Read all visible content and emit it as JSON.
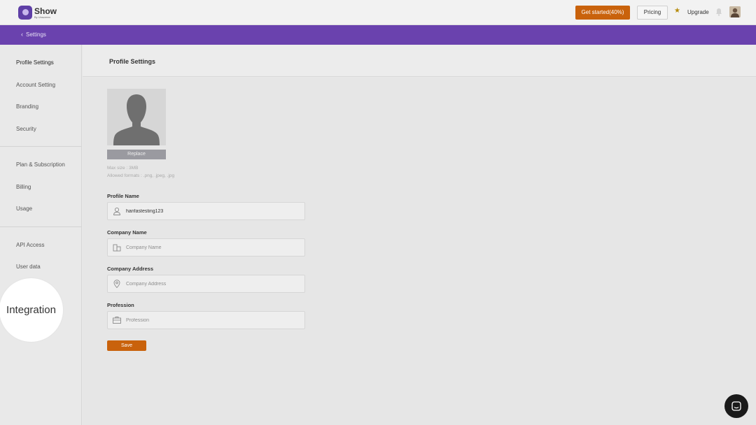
{
  "app": {
    "logo_title": "Show",
    "logo_sub": "By Unscreen",
    "brand_color": "#6a42ae",
    "accent_color": "#c9620c"
  },
  "topbar": {
    "get_started_label": "Get started(40%)",
    "pricing_label": "Pricing",
    "upgrade_label": "Upgrade",
    "icons": [
      "star-icon",
      "bell-icon",
      "avatar"
    ]
  },
  "subbar": {
    "back_label": "Settings",
    "back_icon": "chevron-left-icon"
  },
  "sidebar": {
    "groups": [
      [
        "Profile Settings",
        "Account Setting",
        "Branding",
        "Security"
      ],
      [
        "Plan & Subscription",
        "Billing",
        "Usage"
      ],
      [
        "API Access",
        "User data"
      ]
    ],
    "active": "Profile Settings",
    "spotlight_label": "Integration"
  },
  "main": {
    "title": "Profile Settings",
    "photo": {
      "replace_label": "Replace",
      "max_size": "Max size : 3MB",
      "formats": "Allowed formats : .png, .jpeg, .jpg"
    },
    "fields": {
      "profile_name": {
        "label": "Profile Name",
        "value": "hanfastesting123",
        "placeholder": "",
        "icon": "user-icon"
      },
      "company_name": {
        "label": "Company Name",
        "value": "",
        "placeholder": "Company Name",
        "icon": "building-icon"
      },
      "company_address": {
        "label": "Company Address",
        "value": "",
        "placeholder": "Company Address",
        "icon": "location-pin-icon"
      },
      "profession": {
        "label": "Profession",
        "value": "",
        "placeholder": "Profession",
        "icon": "briefcase-icon"
      }
    },
    "save_label": "Save"
  }
}
